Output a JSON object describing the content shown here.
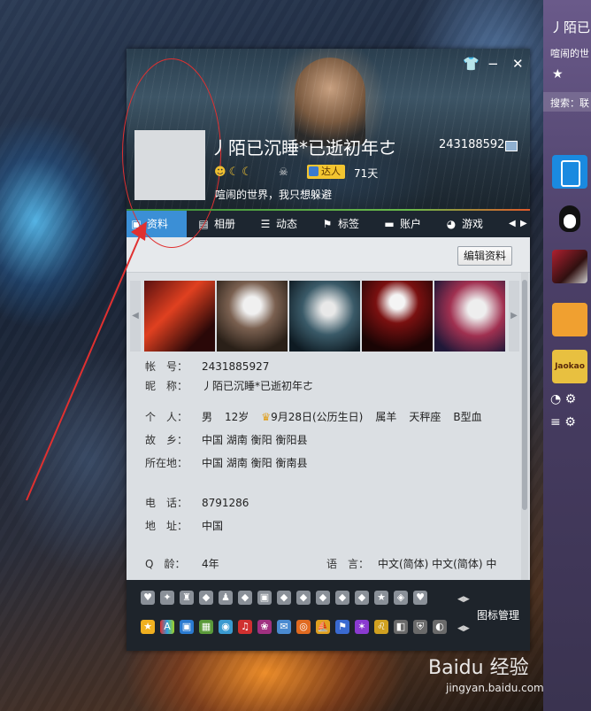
{
  "qq_panel": {
    "name_partial": "丿陌已",
    "sig_partial": "喧闹的世",
    "search_partial": "搜索：联"
  },
  "window": {
    "controls": {
      "skin": "👕",
      "minimize": "−",
      "close": "✕"
    },
    "nickname": "丿陌已沉睡*已逝初年ㄜ",
    "qq_number": "243188592",
    "days": "71天",
    "badge": "达人",
    "signature": "喧闹的世界，我只想躲避",
    "tabs": [
      {
        "label": "资料",
        "icon": "profile-icon",
        "active": true
      },
      {
        "label": "相册",
        "icon": "album-icon"
      },
      {
        "label": "动态",
        "icon": "feed-icon"
      },
      {
        "label": "标签",
        "icon": "tag-icon"
      },
      {
        "label": "账户",
        "icon": "wallet-icon"
      },
      {
        "label": "游戏",
        "icon": "game-icon"
      }
    ],
    "edit_button": "编辑资料"
  },
  "profile": {
    "account": {
      "label": "帐　号：",
      "value": "2431885927"
    },
    "nick": {
      "label": "昵　称：",
      "value": "丿陌已沉睡*已逝初年ㄜ"
    },
    "personal": {
      "label": "个　人：",
      "gender": "男",
      "age": "12岁",
      "birthday": "9月28日(公历生日)",
      "zodiac": "属羊",
      "constellation": "天秤座",
      "blood": "B型血"
    },
    "hometown": {
      "label": "故　乡：",
      "value": "中国 湖南 衡阳 衡阳县"
    },
    "location": {
      "label": "所在地：",
      "value": "中国 湖南 衡阳 衡南县"
    },
    "phone": {
      "label": "电　话：",
      "value": "8791286"
    },
    "address": {
      "label": "地　址：",
      "value": "中国"
    },
    "qage": {
      "label": "Q　龄：",
      "value": "4年"
    },
    "language": {
      "label": "语　言：",
      "value": "中文(简体)  中文(简体)  中"
    }
  },
  "bottom_bar": {
    "icon_manager": "图标管理"
  },
  "watermark": {
    "brand": "Baidu 经验",
    "url": "jingyan.baidu.com"
  },
  "colors": {
    "accent_tab": "#3b8fd6",
    "annotation": "#e03030"
  }
}
